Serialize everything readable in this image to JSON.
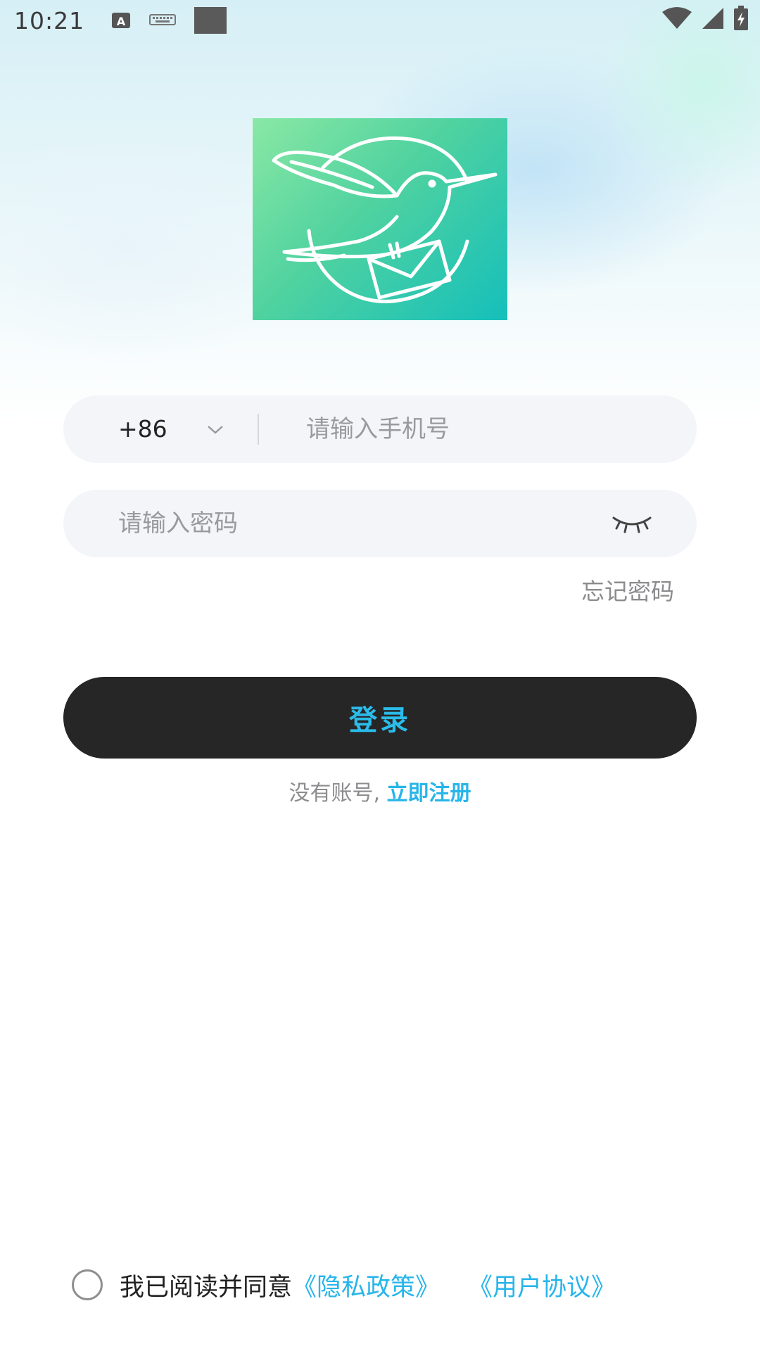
{
  "status_bar": {
    "time": "10:21"
  },
  "login": {
    "country_code": "+86",
    "phone_placeholder": "请输入手机号",
    "password_placeholder": "请输入密码",
    "forgot_password": "忘记密码",
    "login_button": "登录",
    "no_account_text": "没有账号,",
    "register_link": "立即注册"
  },
  "agreement": {
    "text": "我已阅读并同意",
    "privacy_policy": "《隐私政策》",
    "user_agreement": "《用户协议》",
    "checked": false
  },
  "colors": {
    "accent": "#27b5ea",
    "button_bg": "#262626",
    "input_bg": "#f3f5f9",
    "logo_gradient_start": "#8ae8a4",
    "logo_gradient_end": "#15bfbb"
  },
  "icons": [
    "a-icon",
    "keyboard-icon",
    "square-icon",
    "wifi-icon",
    "signal-icon",
    "battery-icon",
    "app-logo-hummingbird",
    "chevron-down-icon",
    "eye-closed-icon"
  ]
}
